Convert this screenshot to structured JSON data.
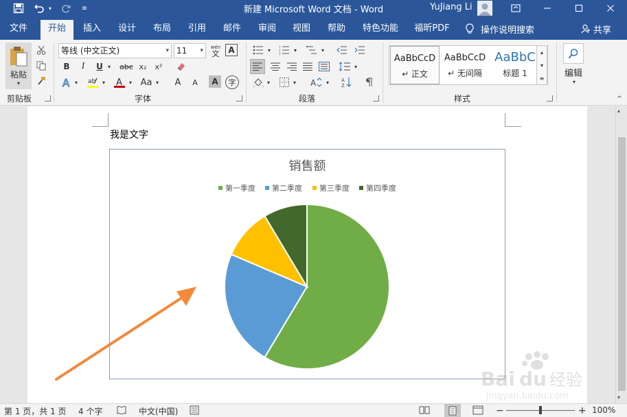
{
  "titlebar": {
    "title": "新建 Microsoft Word 文档  -  Word",
    "user_name": "YuJiang Li",
    "icons": [
      "save-icon",
      "undo-icon",
      "redo-icon",
      "customize-qat-icon",
      "ribbon-display-options-icon",
      "minimize-icon",
      "maximize-icon",
      "close-icon"
    ]
  },
  "tabs": [
    {
      "label": "文件"
    },
    {
      "label": "开始",
      "active": true
    },
    {
      "label": "插入"
    },
    {
      "label": "设计"
    },
    {
      "label": "布局"
    },
    {
      "label": "引用"
    },
    {
      "label": "邮件"
    },
    {
      "label": "审阅"
    },
    {
      "label": "视图"
    },
    {
      "label": "帮助"
    },
    {
      "label": "特色功能"
    },
    {
      "label": "福昕PDF"
    }
  ],
  "tell_me": "操作说明搜索",
  "share": "共享",
  "ribbon": {
    "clipboard": {
      "paste_label": "粘贴",
      "group_label": "剪贴板"
    },
    "font": {
      "font_name": "等线 (中文正文)",
      "font_size": "11",
      "group_label": "字体",
      "buttons": {
        "bold": "B",
        "italic": "I",
        "underline": "U",
        "strike": "abc",
        "subscript": "x₂",
        "superscript": "x²",
        "grow": "A",
        "shrink": "A",
        "case": "Aa",
        "phonetic": "wén",
        "border_char": "A",
        "shading_char": "A",
        "enclose": "字"
      }
    },
    "paragraph": {
      "group_label": "段落"
    },
    "styles": {
      "group_label": "样式",
      "items": [
        {
          "sample": "AaBbCcD",
          "name": "↵ 正文"
        },
        {
          "sample": "AaBbCcD",
          "name": "↵ 无间隔"
        },
        {
          "sample": "AaBbC",
          "name": "标题 1"
        }
      ]
    },
    "editing": {
      "label": "编辑"
    }
  },
  "document": {
    "text": "我是文字"
  },
  "chart_data": {
    "type": "pie",
    "title": "销售额",
    "categories": [
      "第一季度",
      "第二季度",
      "第三季度",
      "第四季度"
    ],
    "values": [
      8.2,
      3.2,
      1.4,
      1.2
    ],
    "colors": [
      "#70ad47",
      "#5b9bd5",
      "#ffc000",
      "#43682b"
    ],
    "legend_position": "top"
  },
  "statusbar": {
    "page": "第 1 页，共 1 页",
    "words": "4 个字",
    "language": "中文(中国)",
    "zoom": "100%"
  },
  "annotation": {
    "arrow_color": "#f28a3a"
  },
  "watermark": {
    "brand": "Bai du 经验",
    "url": "jingyan.baidu.com"
  }
}
